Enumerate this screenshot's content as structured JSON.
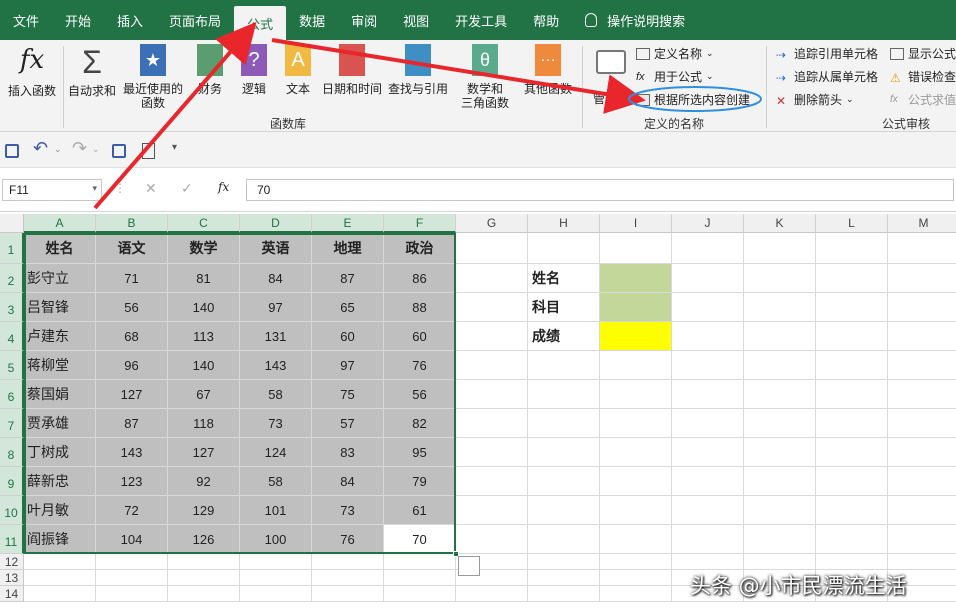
{
  "tabs": [
    "文件",
    "开始",
    "插入",
    "页面布局",
    "公式",
    "数据",
    "审阅",
    "视图",
    "开发工具",
    "帮助"
  ],
  "search_label": "操作说明搜索",
  "ribbon": {
    "insert_fn": "插入函数",
    "autosum": "自动求和",
    "recent_1": "最近使用的",
    "recent_2": "函数",
    "finance": "财务",
    "logical": "逻辑",
    "text": "文本",
    "datetime": "日期和时间",
    "lookup": "查找与引用",
    "math_1": "数学和",
    "math_2": "三角函数",
    "other": "其他函数",
    "group_lib": "函数库",
    "name_mgr": "管理器",
    "define_name": "定义名称",
    "use_in_formula": "用于公式",
    "create_from_sel": "根据所选内容创建",
    "group_names": "定义的名称",
    "trace_prec": "追踪引用单元格",
    "trace_dep": "追踪从属单元格",
    "remove_arrows": "删除箭头",
    "show_formulas": "显示公式",
    "error_check": "错误检查",
    "eval_formula": "公式求值",
    "group_audit": "公式审核"
  },
  "formula_bar": {
    "name_box": "F11",
    "formula": "70"
  },
  "columns": [
    "A",
    "B",
    "C",
    "D",
    "E",
    "F",
    "G",
    "H",
    "I",
    "J",
    "K",
    "L",
    "M"
  ],
  "rows": [
    "1",
    "2",
    "3",
    "4",
    "5",
    "6",
    "7",
    "8",
    "9",
    "10",
    "11",
    "12",
    "13",
    "14"
  ],
  "table": {
    "headers": [
      "姓名",
      "语文",
      "数学",
      "英语",
      "地理",
      "政治"
    ],
    "rows": [
      [
        "彭守立",
        "71",
        "81",
        "84",
        "87",
        "86"
      ],
      [
        "吕智锋",
        "56",
        "140",
        "97",
        "65",
        "88"
      ],
      [
        "卢建东",
        "68",
        "113",
        "131",
        "60",
        "60"
      ],
      [
        "蒋柳堂",
        "96",
        "140",
        "143",
        "97",
        "76"
      ],
      [
        "蔡国娟",
        "127",
        "67",
        "58",
        "75",
        "56"
      ],
      [
        "贾承雄",
        "87",
        "118",
        "73",
        "57",
        "82"
      ],
      [
        "丁树成",
        "143",
        "127",
        "124",
        "83",
        "95"
      ],
      [
        "薛新忠",
        "123",
        "92",
        "58",
        "84",
        "79"
      ],
      [
        "叶月敏",
        "72",
        "129",
        "101",
        "73",
        "61"
      ],
      [
        "阎振锋",
        "104",
        "126",
        "100",
        "76",
        "70"
      ]
    ]
  },
  "lookup_labels": [
    "姓名",
    "科目",
    "成绩"
  ],
  "colors": {
    "green_cell": "#c4d79b",
    "yellow_cell": "#ffff00",
    "selection": "#bfbfbf",
    "accent": "#217346"
  },
  "watermark": "头条 @小市民漂流生活"
}
